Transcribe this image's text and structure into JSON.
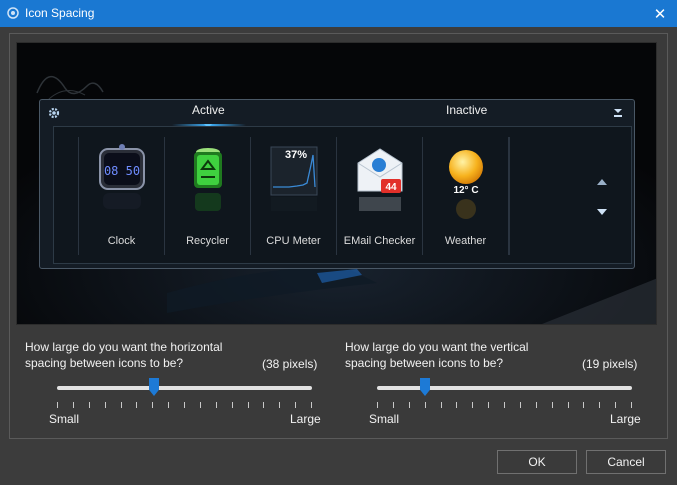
{
  "window": {
    "title": "Icon Spacing",
    "close_glyph": "✕"
  },
  "dock": {
    "tabs": {
      "active": "Active",
      "inactive": "Inactive"
    },
    "gadgets": [
      {
        "name": "clock",
        "label": "Clock",
        "time": "08 50",
        "icon": "clock-icon"
      },
      {
        "name": "recycler",
        "label": "Recycler",
        "icon": "recycler-icon"
      },
      {
        "name": "cpu-meter",
        "label": "CPU Meter",
        "percent": "37%",
        "icon": "cpu-meter-icon"
      },
      {
        "name": "email-checker",
        "label": "EMail Checker",
        "count": "44",
        "icon": "email-icon"
      },
      {
        "name": "weather",
        "label": "Weather",
        "temp": "12° C",
        "icon": "weather-sun-icon"
      }
    ]
  },
  "horizontal": {
    "question_line1": "How large do you want the horizontal",
    "question_line2": "spacing between icons to be?",
    "value_text": "(38 pixels)",
    "value": 38,
    "min_label": "Small",
    "max_label": "Large"
  },
  "vertical": {
    "question_line1": "How large do you want the vertical",
    "question_line2": "spacing between icons to be?",
    "value_text": "(19 pixels)",
    "value": 19,
    "min_label": "Small",
    "max_label": "Large"
  },
  "buttons": {
    "ok": "OK",
    "cancel": "Cancel"
  },
  "colors": {
    "titlebar": "#1a78d2",
    "accent": "#1d7ad6",
    "background": "#3c3c3c"
  }
}
